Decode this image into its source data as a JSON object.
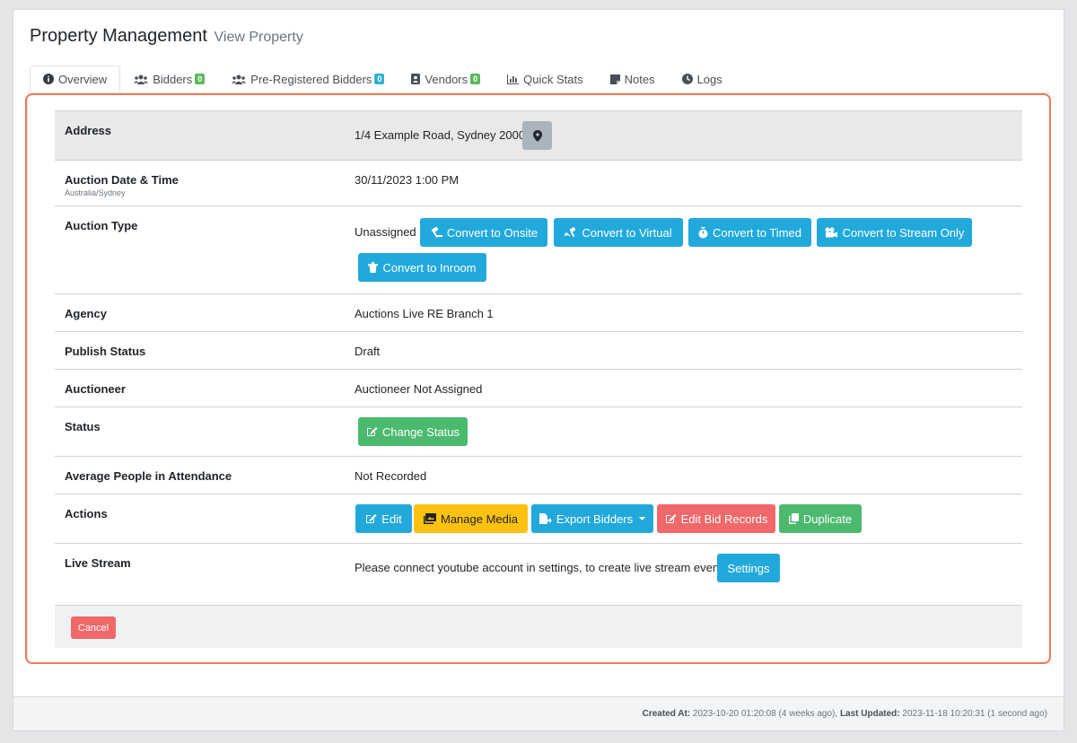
{
  "header": {
    "title": "Property Management",
    "subtitle": "View Property"
  },
  "tabs": [
    {
      "label": "Overview",
      "icon": "info-circle-icon"
    },
    {
      "label": "Bidders",
      "icon": "users-icon",
      "badge": "0",
      "badge_color": "#5cb85c"
    },
    {
      "label": "Pre-Registered Bidders",
      "icon": "users-icon",
      "badge": "0",
      "badge_color": "#31b0d5"
    },
    {
      "label": "Vendors",
      "icon": "id-card-icon",
      "badge": "0",
      "badge_color": "#5cb85c"
    },
    {
      "label": "Quick Stats",
      "icon": "bar-chart-icon"
    },
    {
      "label": "Notes",
      "icon": "sticky-note-icon"
    },
    {
      "label": "Logs",
      "icon": "clock-icon"
    }
  ],
  "rows": {
    "address": {
      "label": "Address",
      "value": "1/4 Example Road, Sydney 2000"
    },
    "auction_date": {
      "label": "Auction Date & Time",
      "sublabel": "Australia/Sydney",
      "value": "30/11/2023 1:00 PM"
    },
    "auction_type": {
      "label": "Auction Type",
      "value": "Unassigned",
      "buttons": [
        "Convert to Onsite",
        "Convert to Virtual",
        "Convert to Timed",
        "Convert to Stream Only",
        "Convert to Inroom"
      ]
    },
    "agency": {
      "label": "Agency",
      "value": "Auctions Live RE Branch 1"
    },
    "publish_status": {
      "label": "Publish Status",
      "value": "Draft"
    },
    "auctioneer": {
      "label": "Auctioneer",
      "value": "Auctioneer Not Assigned"
    },
    "status": {
      "label": "Status",
      "button": "Change Status"
    },
    "attendance": {
      "label": "Average People in Attendance",
      "value": "Not Recorded"
    },
    "actions": {
      "label": "Actions",
      "buttons": [
        "Edit",
        "Manage Media",
        "Export Bidders",
        "Edit Bid Records",
        "Duplicate"
      ]
    },
    "live_stream": {
      "label": "Live Stream",
      "value": "Please connect youtube account in settings, to create live stream event.",
      "button": "Settings"
    }
  },
  "cancel_label": "Cancel",
  "footer": {
    "created_label": "Created At:",
    "created_value": "2023-10-20 01:20:08 (4 weeks ago),",
    "updated_label": "Last Updated:",
    "updated_value": "2023-11-18 10:20:31 (1 second ago)"
  },
  "colors": {
    "info": "#22a9dc",
    "success": "#4cba6e",
    "warning": "#fdc20f",
    "danger": "#f0686a",
    "highlight": "#ec7b53"
  }
}
